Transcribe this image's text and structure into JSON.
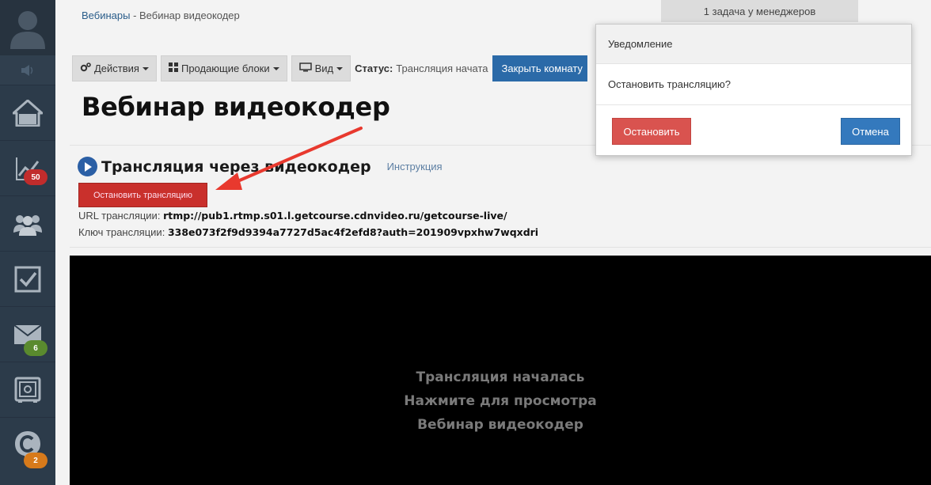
{
  "breadcrumb": {
    "link": "Вебинары",
    "separator": " - ",
    "current": "Вебинар видеокодер"
  },
  "task_notice": "1 задача у менеджеров",
  "toolbar": {
    "actions_label": "Действия",
    "blocks_label": "Продающие блоки",
    "view_label": "Вид",
    "status_label": "Статус:",
    "status_value": "Трансляция начата",
    "close_room_label": "Закрыть комнату"
  },
  "page_title": "Вебинар видеокодер",
  "stream": {
    "title": "Трансляция через видеокодер",
    "instruction_link": "Инструкция",
    "stop_button": "Остановить трансляцию",
    "url_label": "URL трансляции:",
    "url_value": "rtmp://pub1.rtmp.s01.l.getcourse.cdnvideo.ru/getcourse-live/",
    "key_label": "Ключ трансляции:",
    "key_value": "338e073f2f9d9394a7727d5ac4f2efd8?auth=201909vpxhw7wqxdri"
  },
  "video": {
    "line1": "Трансляция началась",
    "line2": "Нажмите для просмотра",
    "line3": "Вебинар видеокодер"
  },
  "sidebar": {
    "badges": {
      "stats": "50",
      "mail": "6",
      "chat": "2"
    },
    "icons": [
      "user-avatar-icon",
      "speaker-icon",
      "home-icon",
      "chart-icon",
      "users-icon",
      "checkbox-icon",
      "mail-icon",
      "safe-icon",
      "chat-icon"
    ]
  },
  "modal": {
    "title": "Уведомление",
    "message": "Остановить трансляцию?",
    "stop_label": "Остановить",
    "cancel_label": "Отмена"
  },
  "colors": {
    "sidebar_bg": "#2c3b4a",
    "badge_red": "#c12c2c",
    "badge_green": "#5a8a2e",
    "badge_orange": "#d77a1b",
    "primary_blue": "#3479bd",
    "danger_red": "#d9534f",
    "arrow_red": "#e8392e"
  }
}
